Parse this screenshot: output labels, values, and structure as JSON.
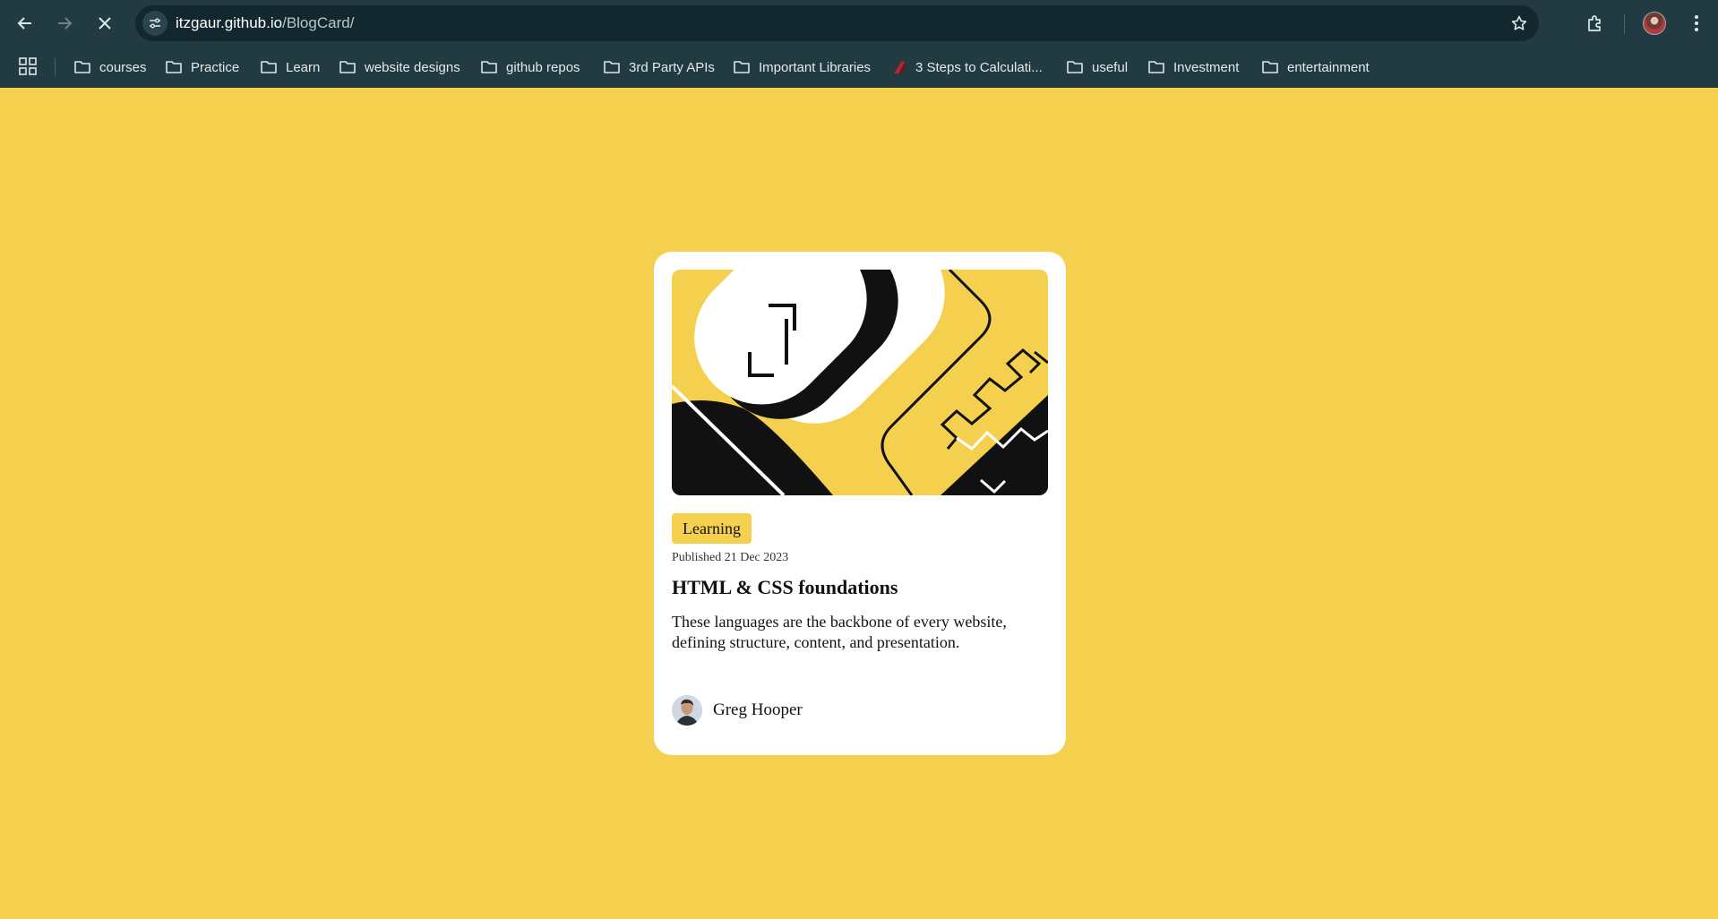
{
  "browser": {
    "url_host": "itzgaur.github.io",
    "url_path": "/BlogCard/",
    "icons": {
      "back": "back-arrow-icon",
      "forward": "forward-arrow-icon",
      "stop": "close-icon",
      "site_info": "tune-icon",
      "bookmark": "star-icon",
      "extensions": "puzzle-icon",
      "menu": "more-vert-icon",
      "apps": "apps-grid-icon"
    }
  },
  "bookmarks": [
    {
      "label": "courses",
      "icon": "folder-icon"
    },
    {
      "label": "Practice",
      "icon": "folder-icon"
    },
    {
      "label": "Learn",
      "icon": "folder-icon"
    },
    {
      "label": "website designs",
      "icon": "folder-icon"
    },
    {
      "label": "github repos",
      "icon": "folder-icon"
    },
    {
      "label": "3rd Party APIs",
      "icon": "folder-icon"
    },
    {
      "label": "Important Libraries",
      "icon": "folder-icon"
    },
    {
      "label": "3 Steps to Calculati...",
      "icon": "site-favicon-icon"
    },
    {
      "label": "useful",
      "icon": "folder-icon"
    },
    {
      "label": "Investment",
      "icon": "folder-icon"
    },
    {
      "label": "entertainment",
      "icon": "folder-icon"
    }
  ],
  "card": {
    "tag": "Learning",
    "published": "Published 21 Dec 2023",
    "title": "HTML & CSS foundations",
    "description": "These languages are the backbone of every website, defining structure, content, and presentation.",
    "author": "Greg Hooper"
  },
  "colors": {
    "page_bg": "#f4d04e",
    "chrome_bg": "#223a42",
    "card_bg": "#ffffff",
    "ink": "#111111"
  }
}
